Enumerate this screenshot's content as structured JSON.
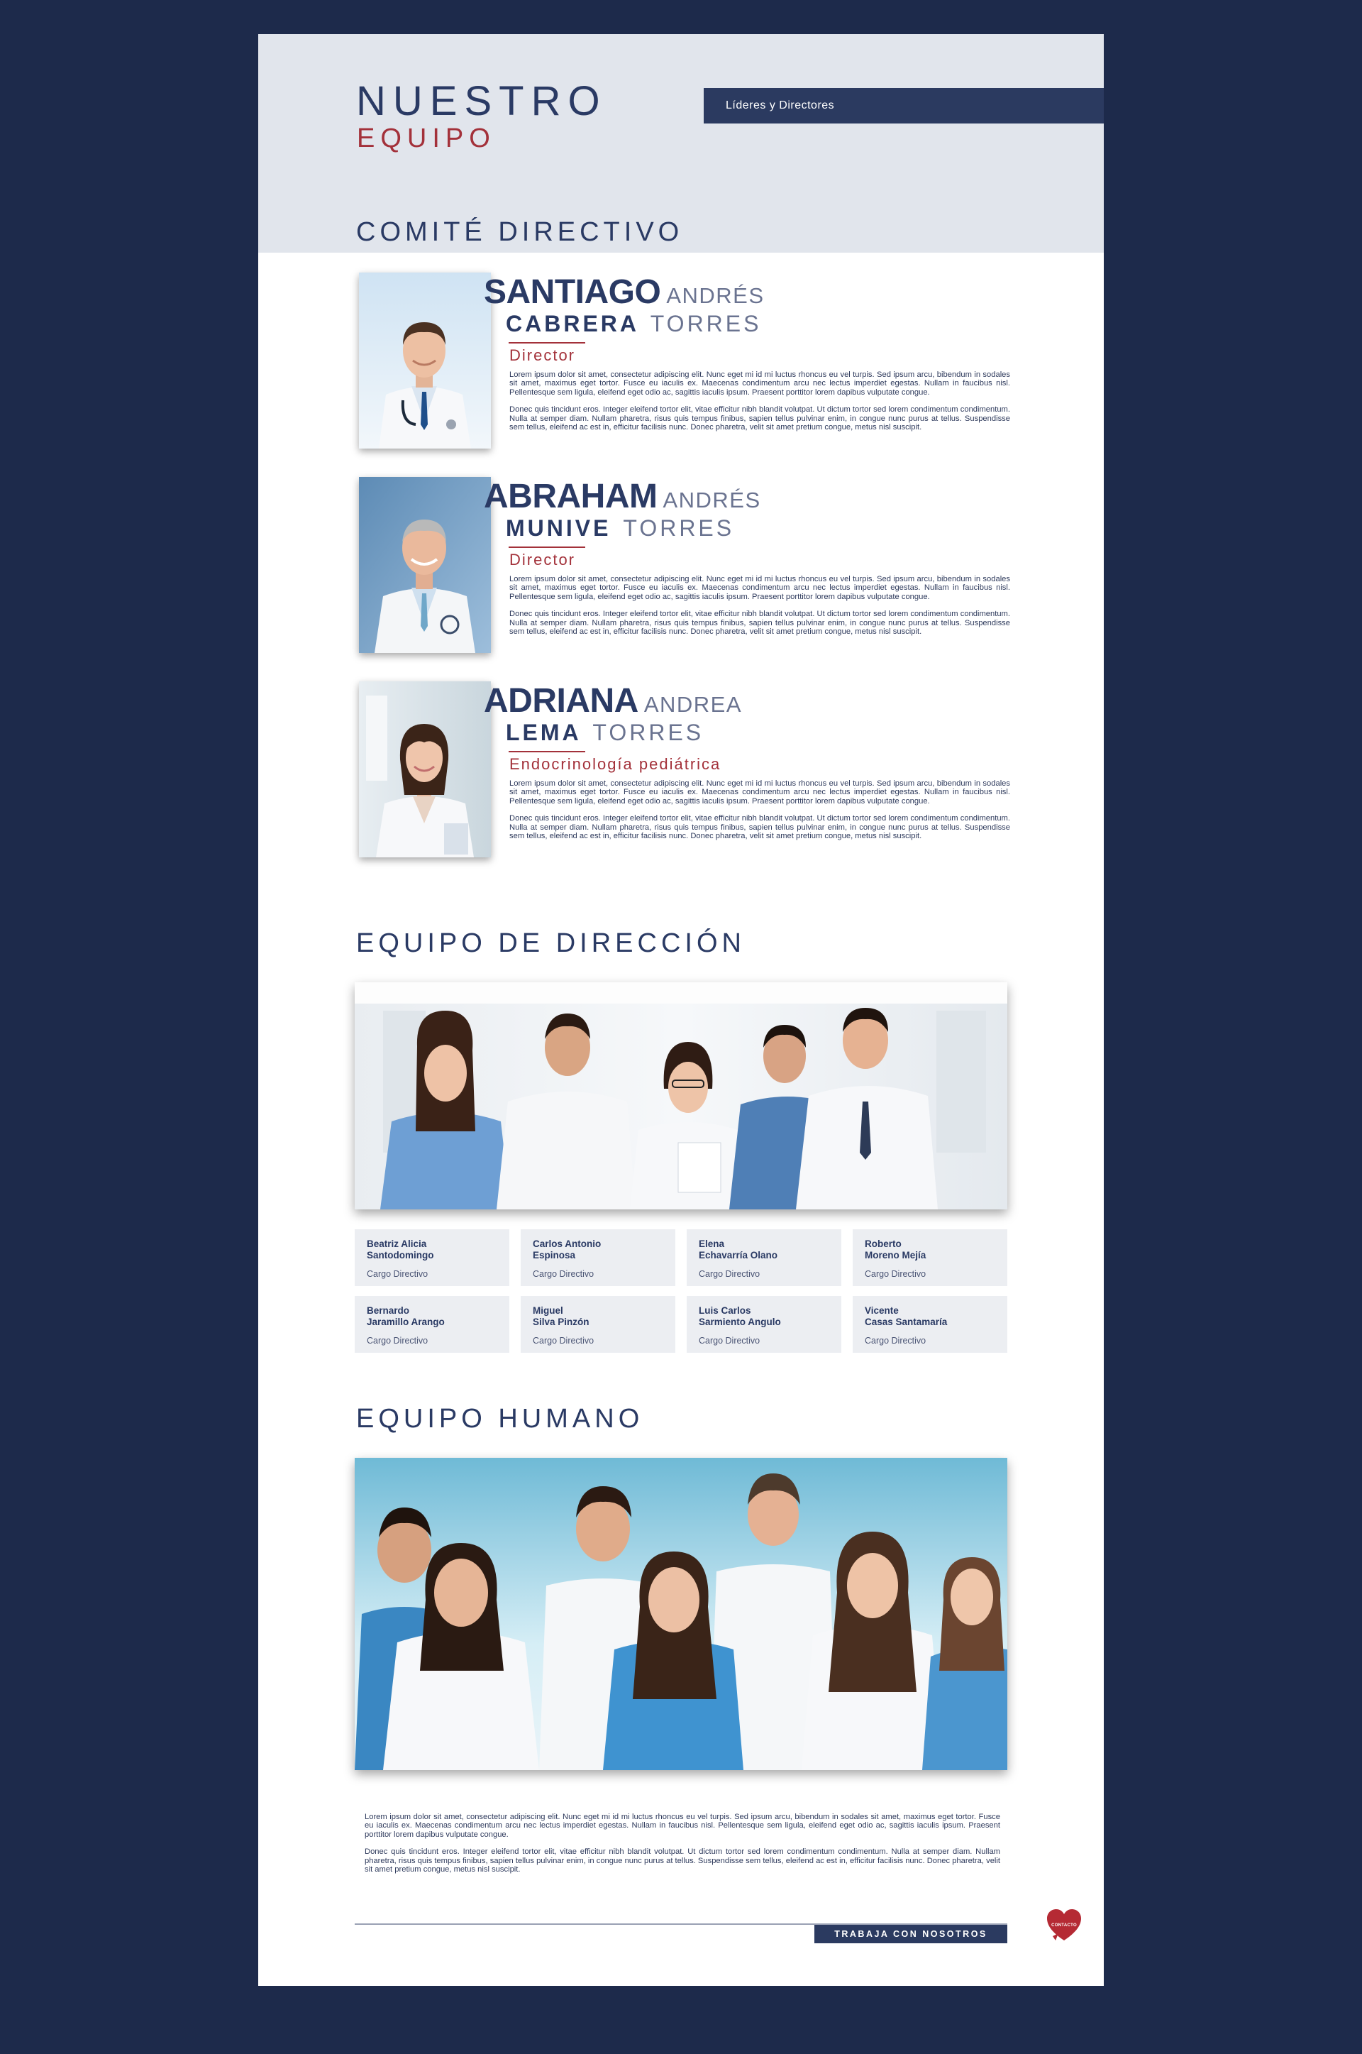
{
  "header": {
    "title_line1": "NUESTRO",
    "title_line2": "EQUIPO",
    "tab_label": "Líderes y Directores"
  },
  "sections": {
    "committee_title": "COMITÉ DIRECTIVO",
    "direction_title": "EQUIPO DE DIRECCIÓN",
    "human_title": "EQUIPO HUMANO"
  },
  "committee": [
    {
      "first_name": "SANTIAGO",
      "middle_name": "ANDRÉS",
      "last_name": "CABRERA",
      "second_last_name": "TORRES",
      "role": "Director",
      "bio_p1": "Lorem ipsum dolor sit amet, consectetur adipiscing elit. Nunc eget mi id mi luctus rhoncus eu vel turpis. Sed ipsum arcu, bibendum in sodales sit amet, maximus eget tortor. Fusce eu iaculis ex. Maecenas condimentum arcu nec lectus imperdiet egestas. Nullam in faucibus nisl. Pellentesque sem ligula, eleifend eget odio ac, sagittis iaculis ipsum. Praesent porttitor lorem dapibus vulputate congue.",
      "bio_p2": "Donec quis tincidunt eros. Integer eleifend tortor elit, vitae efficitur nibh blandit volutpat. Ut dictum tortor sed lorem condimentum condimentum. Nulla at semper diam. Nullam pharetra, risus quis tempus finibus, sapien tellus pulvinar enim, in congue nunc purus at tellus. Suspendisse sem tellus, eleifend ac est in, efficitur facilisis nunc. Donec pharetra, velit sit amet pretium congue, metus nisl suscipit."
    },
    {
      "first_name": "ABRAHAM",
      "middle_name": "ANDRÉS",
      "last_name": "MUNIVE",
      "second_last_name": "TORRES",
      "role": "Director",
      "bio_p1": "Lorem ipsum dolor sit amet, consectetur adipiscing elit. Nunc eget mi id mi luctus rhoncus eu vel turpis. Sed ipsum arcu, bibendum in sodales sit amet, maximus eget tortor. Fusce eu iaculis ex. Maecenas condimentum arcu nec lectus imperdiet egestas. Nullam in faucibus nisl. Pellentesque sem ligula, eleifend eget odio ac, sagittis iaculis ipsum. Praesent porttitor lorem dapibus vulputate congue.",
      "bio_p2": "Donec quis tincidunt eros. Integer eleifend tortor elit, vitae efficitur nibh blandit volutpat. Ut dictum tortor sed lorem condimentum condimentum. Nulla at semper diam. Nullam pharetra, risus quis tempus finibus, sapien tellus pulvinar enim, in congue nunc purus at tellus. Suspendisse sem tellus, eleifend ac est in, efficitur facilisis nunc. Donec pharetra, velit sit amet pretium congue, metus nisl suscipit."
    },
    {
      "first_name": "ADRIANA",
      "middle_name": "ANDREA",
      "last_name": "LEMA",
      "second_last_name": "TORRES",
      "role": "Endocrinología pediátrica",
      "bio_p1": "Lorem ipsum dolor sit amet, consectetur adipiscing elit. Nunc eget mi id mi luctus rhoncus eu vel turpis. Sed ipsum arcu, bibendum in sodales sit amet, maximus eget tortor. Fusce eu iaculis ex. Maecenas condimentum arcu nec lectus imperdiet egestas. Nullam in faucibus nisl. Pellentesque sem ligula, eleifend eget odio ac, sagittis iaculis ipsum. Praesent porttitor lorem dapibus vulputate congue.",
      "bio_p2": "Donec quis tincidunt eros. Integer eleifend tortor elit, vitae efficitur nibh blandit volutpat. Ut dictum tortor sed lorem condimentum condimentum. Nulla at semper diam. Nullam pharetra, risus quis tempus finibus, sapien tellus pulvinar enim, in congue nunc purus at tellus. Suspendisse sem tellus, eleifend ac est in, efficitur facilisis nunc. Donec pharetra, velit sit amet pretium congue, metus nisl suscipit."
    }
  ],
  "direction_team": [
    {
      "name": "Beatriz Alicia\nSantodomingo",
      "role": "Cargo Directivo"
    },
    {
      "name": "Carlos Antonio\nEspinosa",
      "role": "Cargo Directivo"
    },
    {
      "name": "Elena\nEchavarría Olano",
      "role": "Cargo Directivo"
    },
    {
      "name": "Roberto\nMoreno Mejía",
      "role": "Cargo Directivo"
    },
    {
      "name": "Bernardo\nJaramillo Arango",
      "role": "Cargo Directivo"
    },
    {
      "name": "Miguel\nSilva Pinzón",
      "role": "Cargo Directivo"
    },
    {
      "name": "Luis Carlos\nSarmiento Angulo",
      "role": "Cargo Directivo"
    },
    {
      "name": "Vicente\nCasas Santamaría",
      "role": "Cargo Directivo"
    }
  ],
  "footer": {
    "text_p1": "Lorem ipsum dolor sit amet, consectetur adipiscing elit. Nunc eget mi id mi luctus rhoncus eu vel turpis. Sed ipsum arcu, bibendum in sodales sit amet, maximus eget tortor. Fusce eu iaculis ex. Maecenas condimentum arcu nec lectus imperdiet egestas. Nullam in faucibus nisl. Pellentesque sem ligula, eleifend eget odio ac, sagittis iaculis ipsum. Praesent porttitor lorem dapibus vulputate congue.",
    "text_p2": "Donec quis tincidunt eros. Integer eleifend tortor elit, vitae efficitur nibh blandit volutpat. Ut dictum tortor sed lorem condimentum condimentum. Nulla at semper diam. Nullam pharetra, risus quis tempus finibus, sapien tellus pulvinar enim, in congue nunc purus at tellus. Suspendisse sem tellus, eleifend ac est in, efficitur facilisis nunc. Donec pharetra, velit sit amet pretium congue, metus nisl suscipit.",
    "work_button": "TRABAJA CON NOSOTROS",
    "contact_label": "CONTACTO"
  },
  "colors": {
    "background": "#1d2a4b",
    "header_band": "#e1e5ec",
    "primary_navy": "#2a3a64",
    "accent_red": "#a3313a",
    "card_bg": "#eceef2"
  },
  "icons": {
    "contact": "heart-icon"
  }
}
